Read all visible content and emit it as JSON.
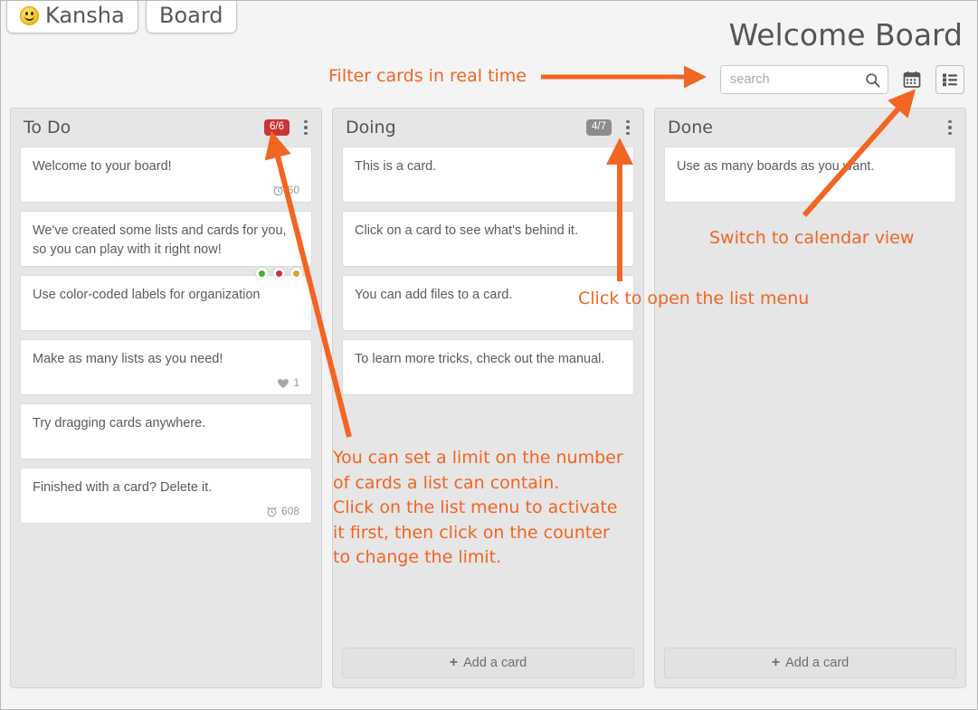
{
  "tabs": [
    {
      "id": "kansha",
      "label": "Kansha",
      "icon": "smiley-icon"
    },
    {
      "id": "board",
      "label": "Board"
    }
  ],
  "header": {
    "board_title": "Welcome Board"
  },
  "toolbar": {
    "search_placeholder": "search",
    "search_value": "",
    "search_icon": "search-icon",
    "calendar_button_icon": "calendar-icon",
    "listview_button_icon": "list-view-icon",
    "listview_active": true
  },
  "colors": {
    "accent_orange": "#f26522",
    "badge_red": "#cc3333",
    "badge_gray": "#8c8c8c",
    "label_green": "#3cb521",
    "label_red": "#cc3333",
    "label_orange": "#dfa035",
    "text_gray": "#5b5b5b",
    "list_bg": "#e6e6e6",
    "page_bg": "#f4f4f4"
  },
  "lists": [
    {
      "title": "To Do",
      "badge": {
        "text": "6/6",
        "style": "red"
      },
      "menu_icon": "vertical-dots-icon",
      "add_card_label": null,
      "cards": [
        {
          "text": "Welcome to your board!",
          "meta": {
            "icon": "alarm-clock-icon",
            "value": "60"
          },
          "labels": []
        },
        {
          "text": "We've created some lists and cards for you, so you can play with it right now!",
          "meta": null,
          "labels": []
        },
        {
          "text": "Use color-coded labels for organization",
          "meta": null,
          "labels": [
            "#3cb521",
            "#cc3333",
            "#dfa035"
          ]
        },
        {
          "text": "Make as many lists as you need!",
          "meta": {
            "icon": "heart-icon",
            "value": "1"
          },
          "labels": []
        },
        {
          "text": "Try dragging cards anywhere.",
          "meta": null,
          "labels": []
        },
        {
          "text": "Finished with a card? Delete it.",
          "meta": {
            "icon": "alarm-clock-icon",
            "value": "608"
          },
          "labels": []
        }
      ]
    },
    {
      "title": "Doing",
      "badge": {
        "text": "4/7",
        "style": "gray"
      },
      "menu_icon": "vertical-dots-icon",
      "add_card_label": "Add a card",
      "cards": [
        {
          "text": "This is a card.",
          "meta": null,
          "labels": []
        },
        {
          "text": "Click on a card to see what's behind it.",
          "meta": null,
          "labels": []
        },
        {
          "text": "You can add files to a card.",
          "meta": null,
          "labels": []
        },
        {
          "text": "To learn more tricks, check out the manual.",
          "meta": null,
          "labels": []
        }
      ]
    },
    {
      "title": "Done",
      "badge": null,
      "menu_icon": "vertical-dots-icon",
      "add_card_label": "Add a card",
      "cards": [
        {
          "text": "Use as many boards as you want.",
          "meta": null,
          "labels": []
        }
      ]
    }
  ],
  "annotations": [
    {
      "id": "filter",
      "text": "Filter cards in real time"
    },
    {
      "id": "calendar",
      "text": "Switch to calendar view"
    },
    {
      "id": "listmenu",
      "text": "Click to open the list menu"
    },
    {
      "id": "limit",
      "text": "You can set a limit on the number\nof cards a list can contain.\nClick on the list menu to activate\nit first, then click on the counter\nto change the limit."
    }
  ]
}
